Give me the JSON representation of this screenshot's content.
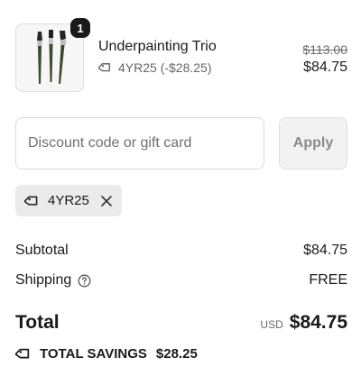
{
  "product": {
    "name": "Underpainting Trio",
    "quantity": "1",
    "discount_label": "4YR25 (-$28.25)",
    "original_price": "$113.00",
    "price": "$84.75",
    "image_icon": "paintbrush-set-image"
  },
  "discount": {
    "placeholder": "Discount code or gift card",
    "value": "",
    "apply_label": "Apply",
    "applied_code": "4YR25"
  },
  "summary": {
    "subtotal_label": "Subtotal",
    "subtotal_value": "$84.75",
    "shipping_label": "Shipping",
    "shipping_value": "FREE",
    "total_label": "Total",
    "currency": "USD",
    "total_value": "$84.75",
    "savings_label": "TOTAL SAVINGS",
    "savings_value": "$28.25"
  },
  "colors": {
    "text": "#1a1a1a",
    "muted": "#6b6b6b",
    "chip_bg": "#ebebeb",
    "button_bg": "#f2f2f2",
    "badge_bg": "#1a1a1a"
  }
}
